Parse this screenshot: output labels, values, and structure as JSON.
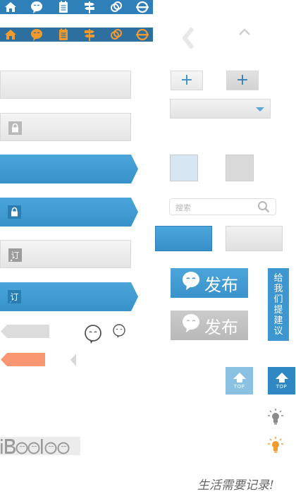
{
  "icon_strips": {
    "blue_strip_icons": [
      "home-icon",
      "chat-bubble-icon",
      "notepad-icon",
      "signpost-icon",
      "link-rings-icon",
      "metro-icon"
    ],
    "orange_strip_icons": [
      "home-icon",
      "chat-bubble-icon",
      "notepad-icon",
      "signpost-icon",
      "link-rings-icon",
      "metro-icon"
    ],
    "blue_strip_color": "#2f7fb8",
    "icon_active_color": "#f29a2e"
  },
  "inputs": {
    "book_glyph": "订"
  },
  "controls": {
    "plus_label": "+",
    "search_placeholder": "搜索"
  },
  "publish": {
    "label": "发布"
  },
  "feedback": {
    "label": "给我们提建议"
  },
  "top_button": {
    "label": "TOP"
  },
  "brand": {
    "logo_text": "iBooloo",
    "slogan": "生活需要记录!"
  },
  "colors": {
    "accent_blue": "#3d96cf",
    "accent_orange": "#f89672",
    "disabled_gray": "#c4c4c4"
  }
}
